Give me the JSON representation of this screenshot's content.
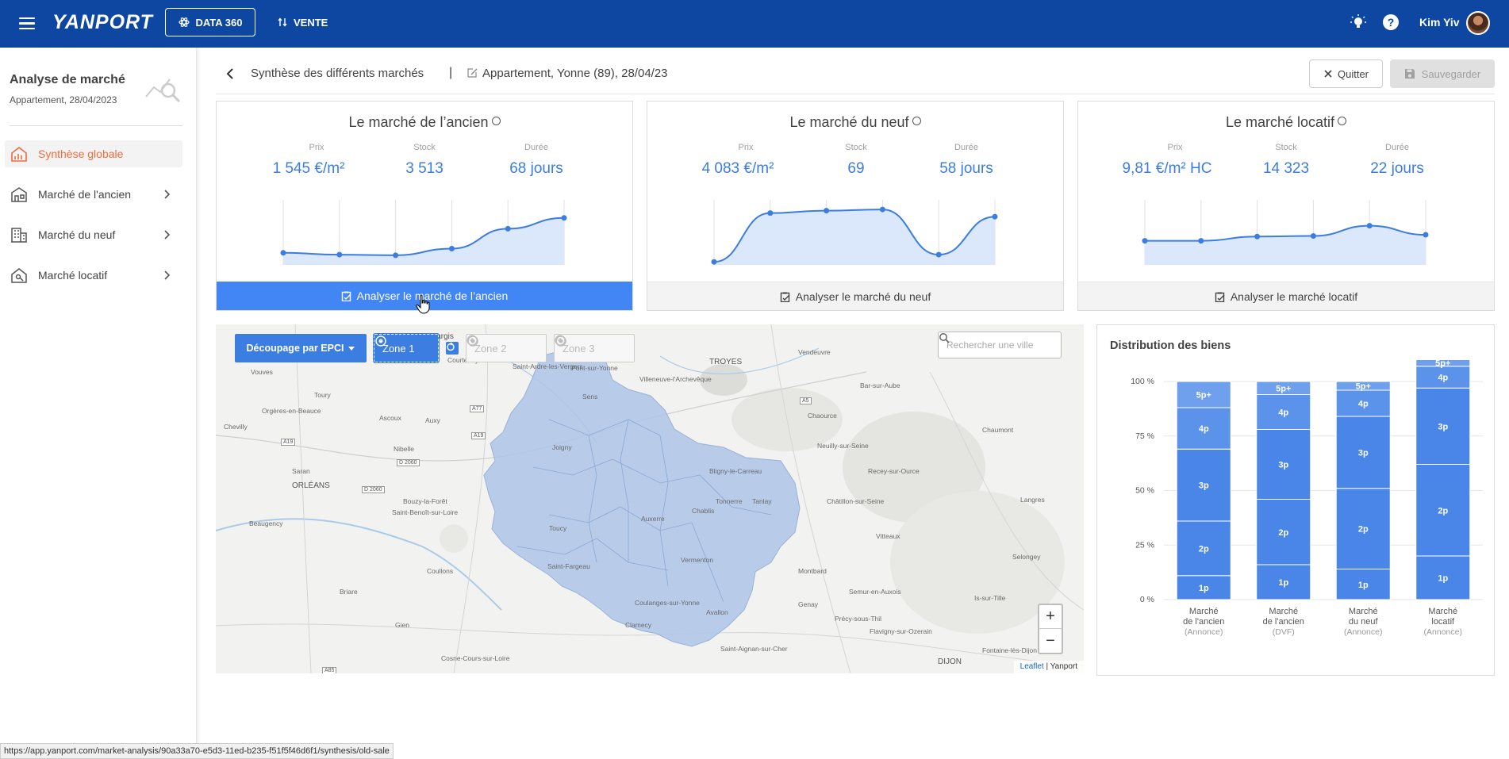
{
  "topbar": {
    "logo": "YANPORT",
    "data360_label": "DATA 360",
    "vente_label": "VENTE",
    "user_name": "Kim Yiv"
  },
  "sidebar": {
    "title": "Analyse de marché",
    "subtitle": "Appartement, 28/04/2023",
    "items": [
      {
        "label": "Synthèse globale",
        "active": true
      },
      {
        "label": "Marché de l'ancien"
      },
      {
        "label": "Marché du neuf"
      },
      {
        "label": "Marché locatif"
      }
    ]
  },
  "header": {
    "title": "Synthèse des différents marchés",
    "separator": "|",
    "subtitle": "Appartement, Yonne (89), 28/04/23",
    "quit_label": "Quitter",
    "save_label": "Sauvegarder"
  },
  "cards": [
    {
      "title": "Le marché de l’ancien",
      "stats": [
        {
          "label": "Prix",
          "value": "1 545 €/m²"
        },
        {
          "label": "Stock",
          "value": "3 513"
        },
        {
          "label": "Durée",
          "value": "68 jours"
        }
      ],
      "trend": [
        0.2,
        0.17,
        0.16,
        0.27,
        0.6,
        0.78
      ],
      "button": "Analyser le marché de l’ancien",
      "primary": true
    },
    {
      "title": "Le marché du neuf",
      "stats": [
        {
          "label": "Prix",
          "value": "4 083 €/m²"
        },
        {
          "label": "Stock",
          "value": "69"
        },
        {
          "label": "Durée",
          "value": "58 jours"
        }
      ],
      "trend": [
        0.05,
        0.86,
        0.9,
        0.92,
        0.17,
        0.8
      ],
      "button": "Analyser le marché du neuf",
      "primary": false
    },
    {
      "title": "Le marché locatif",
      "stats": [
        {
          "label": "Prix",
          "value": "9,81 €/m² HC"
        },
        {
          "label": "Stock",
          "value": "14 323"
        },
        {
          "label": "Durée",
          "value": "22 jours"
        }
      ],
      "trend": [
        0.4,
        0.4,
        0.47,
        0.48,
        0.65,
        0.5
      ],
      "button": "Analyser le marché locatif",
      "primary": false
    }
  ],
  "map": {
    "decoupage_label": "Découpage par EPCI",
    "zones": [
      "Zone 1",
      "Zone 2",
      "Zone 3"
    ],
    "search_placeholder": "Rechercher une ville",
    "zoom_in": "+",
    "zoom_out": "−",
    "attribution_link": "Leaflet",
    "attribution_sep": "|",
    "attribution_text": "Yanport",
    "place_labels": [
      "Vouves",
      "Toury",
      "Orgères-en-Beauce",
      "Ascoux",
      "Auxy",
      "Chevilly",
      "Nibelle",
      "Saran",
      "Bouzy-la-Forêt",
      "ORLÉANS",
      "Saint-Benoît-sur-Loire",
      "Beaugency",
      "Coullons",
      "Montargis",
      "Courtenay",
      "Saint-Ardre-les-Vergers",
      "TROYES",
      "Bar-sur-Aube",
      "Vendeuvre",
      "Chaumont",
      "Langres",
      "Gien",
      "Briare",
      "Cosne-Cours-sur-Loire",
      "Clamecy",
      "Avallon",
      "Montbard",
      "Semur-en-Auxois",
      "DIJON",
      "Sens",
      "Auxerre",
      "Tonnerre",
      "Joigny",
      "Chablis",
      "Saint-Fargeau",
      "Toucy",
      "Coulanges-sur-Yonne",
      "Vermenton",
      "Pont-sur-Yonne",
      "Villeneuve-l'Archevêque",
      "Saint-Aignan-sur-Cher",
      "Genay",
      "Précy-sous-Thil",
      "Vitteaux",
      "Flavigny-sur-Ozerain",
      "Is-sur-Tille",
      "Fontaine-lès-Dijon",
      "Selongey",
      "Châtillon-sur-Seine",
      "Recey-sur-Ource",
      "Neuilly-sur-Seine",
      "Bligny-le-Carreau",
      "Tanlay",
      "Chaource"
    ],
    "road_labels": [
      "A77",
      "A19",
      "D 2060",
      "A5",
      "A19",
      "D 2060",
      "A85"
    ]
  },
  "distribution": {
    "title": "Distribution des biens"
  },
  "chart_data": {
    "type": "bar",
    "stacked": true,
    "categories": [
      "Marché de l'ancien (Annonce)",
      "Marché de l'ancien (DVF)",
      "Marché du neuf (Annonce)",
      "Marché locatif (Annonce)"
    ],
    "category_lines": [
      [
        "Marché",
        "de l'ancien",
        "(Annonce)"
      ],
      [
        "Marché",
        "de l'ancien",
        "(DVF)"
      ],
      [
        "Marché",
        "du neuf",
        "(Annonce)"
      ],
      [
        "Marché",
        "locatif",
        "(Annonce)"
      ]
    ],
    "series": [
      {
        "name": "1p",
        "values": [
          11,
          16,
          14,
          20
        ]
      },
      {
        "name": "2p",
        "values": [
          25,
          30,
          37,
          42
        ]
      },
      {
        "name": "3p",
        "values": [
          33,
          32,
          33,
          35
        ]
      },
      {
        "name": "4p",
        "values": [
          19,
          16,
          12,
          10
        ]
      },
      {
        "name": "5p+",
        "values": [
          12,
          6,
          4,
          3
        ]
      }
    ],
    "yticks": [
      "0 %",
      "25 %",
      "50 %",
      "75 %",
      "100 %"
    ],
    "ylim": [
      0,
      100
    ],
    "colors": {
      "bar": "#4a86e8",
      "bar_top": "#6fa0ee",
      "label": "#ffffff"
    }
  },
  "status_url": "https://app.yanport.com/market-analysis/90a33a70-e5d3-11ed-b235-f51f5f46d6f1/synthesis/old-sale",
  "colors": {
    "brand": "#0d47a1",
    "accent": "#3b7de0",
    "active": "#ef6c3c",
    "zone": "#aec6ea"
  }
}
